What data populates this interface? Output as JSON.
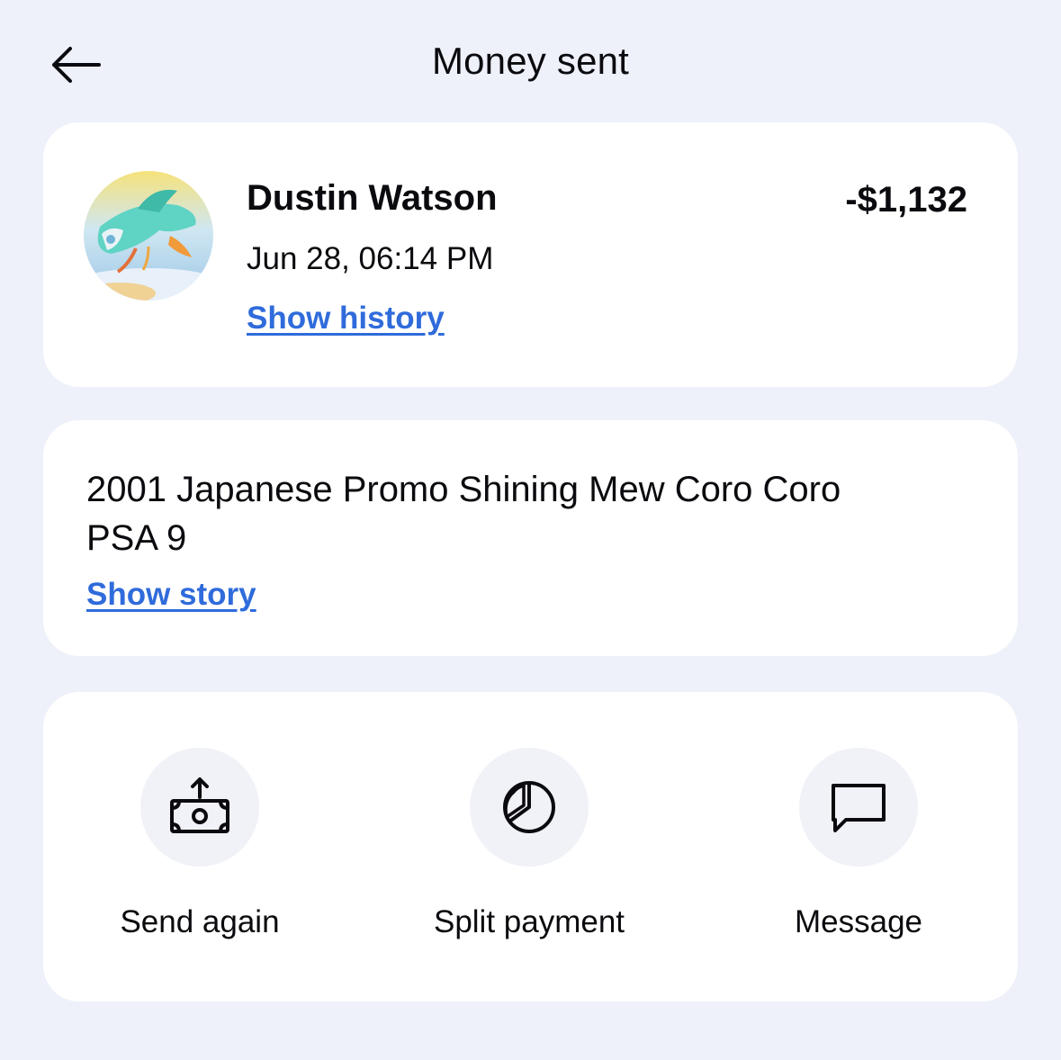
{
  "header": {
    "title": "Money sent",
    "back_icon": "arrow-left-icon"
  },
  "contact": {
    "name": "Dustin Watson",
    "date": "Jun 28, 06:14 PM",
    "history_link": "Show history",
    "amount": "-$1,132"
  },
  "note": {
    "text": "2001 Japanese Promo Shining Mew Coro Coro PSA 9",
    "story_link": "Show story"
  },
  "actions": [
    {
      "label": "Send again",
      "icon": "send-money-icon"
    },
    {
      "label": "Split payment",
      "icon": "pie-chart-icon"
    },
    {
      "label": "Message",
      "icon": "chat-bubble-icon"
    }
  ],
  "colors": {
    "background": "#EEF1FA",
    "card": "#FFFFFF",
    "link": "#2F6BDB",
    "text": "#0B0B0F",
    "icon_circle": "#F0F2F8"
  }
}
